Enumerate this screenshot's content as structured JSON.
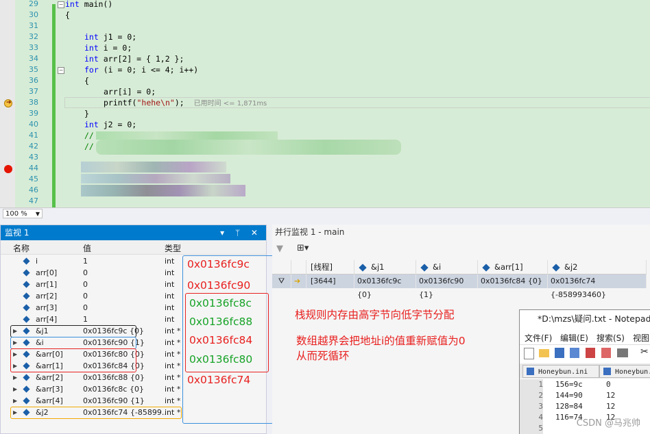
{
  "editor": {
    "lines": [
      "29",
      "30",
      "31",
      "32",
      "33",
      "34",
      "35",
      "36",
      "37",
      "38",
      "39",
      "40",
      "41",
      "42",
      "43",
      "44",
      "45",
      "46",
      "47"
    ],
    "code": {
      "l29_kw": "int",
      "l29_rest": " main()",
      "l30": "{",
      "l32_kw": "int",
      "l32_rest": " j1 = 0;",
      "l33_kw": "int",
      "l33_rest": " i = 0;",
      "l34_kw": "int",
      "l34_rest": " arr[2] = { 1,2 };",
      "l35_kw": "for",
      "l35_rest": " (i = 0; i <= 4; i++)",
      "l36": "{",
      "l37": "arr[i] = 0;",
      "l38_pre": "printf(",
      "l38_str": "\"hehe\\n\"",
      "l38_post": ");",
      "l38_hint": "已用时间 <= 1,871ms",
      "l39": "}",
      "l40_kw": "int",
      "l40_rest": " j2 = 0;",
      "l41": "//",
      "l42": "//"
    },
    "zoom": "100 %"
  },
  "watch": {
    "title": "监视 1",
    "title_icons": "▾ ᛘ ✕",
    "headers": {
      "name": "名称",
      "value": "值",
      "type": "类型"
    },
    "rows": [
      {
        "name": "i",
        "value": "1",
        "type": "int",
        "expand": ""
      },
      {
        "name": "arr[0]",
        "value": "0",
        "type": "int",
        "expand": ""
      },
      {
        "name": "arr[1]",
        "value": "0",
        "type": "int",
        "expand": ""
      },
      {
        "name": "arr[2]",
        "value": "0",
        "type": "int",
        "expand": ""
      },
      {
        "name": "arr[3]",
        "value": "0",
        "type": "int",
        "expand": ""
      },
      {
        "name": "arr[4]",
        "value": "1",
        "type": "int",
        "expand": ""
      },
      {
        "name": "&j1",
        "value": "0x0136fc9c {0}",
        "type": "int *",
        "expand": "▶"
      },
      {
        "name": "&i",
        "value": "0x0136fc90 {1}",
        "type": "int *",
        "expand": "▶"
      },
      {
        "name": "&arr[0]",
        "value": "0x0136fc80 {0}",
        "type": "int *",
        "expand": "▶"
      },
      {
        "name": "&arr[1]",
        "value": "0x0136fc84 {0}",
        "type": "int *",
        "expand": "▶"
      },
      {
        "name": "&arr[2]",
        "value": "0x0136fc88 {0}",
        "type": "int *",
        "expand": "▶"
      },
      {
        "name": "&arr[3]",
        "value": "0x0136fc8c {0}",
        "type": "int *",
        "expand": "▶"
      },
      {
        "name": "&arr[4]",
        "value": "0x0136fc90 {1}",
        "type": "int *",
        "expand": "▶"
      },
      {
        "name": "&j2",
        "value": "0x0136fc74 {-85899...",
        "type": "int *",
        "expand": "▶"
      }
    ]
  },
  "annotations": {
    "addr_j1": "0x0136fc9c",
    "addr_i": "0x0136fc90",
    "addr_8c": "0x0136fc8c",
    "addr_88": "0x0136fc88",
    "addr_84": "0x0136fc84",
    "addr_80": "0x0136fc80",
    "addr_74": "0x0136fc74",
    "note1": "栈规则内存由高字节向低字节分配",
    "note2": "数组越界会把地址i的值重新赋值为0",
    "note3": "从而死循环"
  },
  "parallel": {
    "title": "并行监视 1 - main",
    "headers": [
      "[线程]",
      "&j1",
      "&i",
      "&arr[1]",
      "&j2"
    ],
    "row": [
      "[3644]",
      "0x0136fc9c {0}",
      "0x0136fc90 {1}",
      "0x0136fc84 {0}",
      "0x0136fc74 {-858993460}"
    ]
  },
  "notepad": {
    "title": "*D:\\mzs\\疑问.txt - Notepad+",
    "menu": [
      "文件(F)",
      "编辑(E)",
      "搜索(S)",
      "视图"
    ],
    "tabs": [
      "Honeybun.ini",
      "Honeybun."
    ],
    "lines": [
      {
        "n": "1",
        "t": "156=9c",
        "v": "0"
      },
      {
        "n": "2",
        "t": "144=90",
        "v": "12"
      },
      {
        "n": "3",
        "t": "128=84",
        "v": "12"
      },
      {
        "n": "4",
        "t": "116=74",
        "v": "12"
      },
      {
        "n": "5",
        "t": "",
        "v": ""
      }
    ]
  },
  "watermark": "CSDN @马兆帅",
  "colors": {
    "annotation_red": "#e8201f",
    "annotation_green": "#17a327",
    "box_blue": "#3b8fdc",
    "accent": "#007acc"
  }
}
